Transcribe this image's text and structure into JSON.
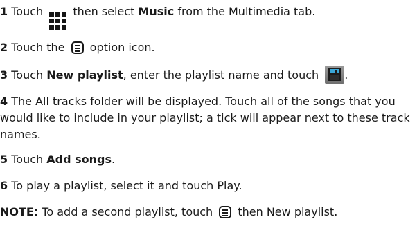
{
  "steps": [
    {
      "num": "1",
      "t1": " Touch ",
      "icon": "grid-icon",
      "t2": " then select ",
      "b1": "Music",
      "t3": " from the Multimedia tab."
    },
    {
      "num": "2",
      "t1": " Touch the ",
      "icon": "menu-option-icon",
      "t2": " option icon."
    },
    {
      "num": "3",
      "t1": " Touch ",
      "b1": "New playlist",
      "t2": ", enter the playlist name and touch ",
      "icon": "save-icon",
      "t3": "."
    },
    {
      "num": "4",
      "t1": " The All tracks folder will be displayed. Touch all of the songs that you would like to include in your playlist; a tick will appear next to these track names."
    },
    {
      "num": "5",
      "t1": " Touch ",
      "b1": "Add songs",
      "t2": "."
    },
    {
      "num": "6",
      "t1": " To play a playlist, select it and touch Play."
    }
  ],
  "note": {
    "label": "NOTE:",
    "t1": " To add a second playlist, touch ",
    "icon": "menu-option-icon",
    "t2": " then New playlist."
  }
}
